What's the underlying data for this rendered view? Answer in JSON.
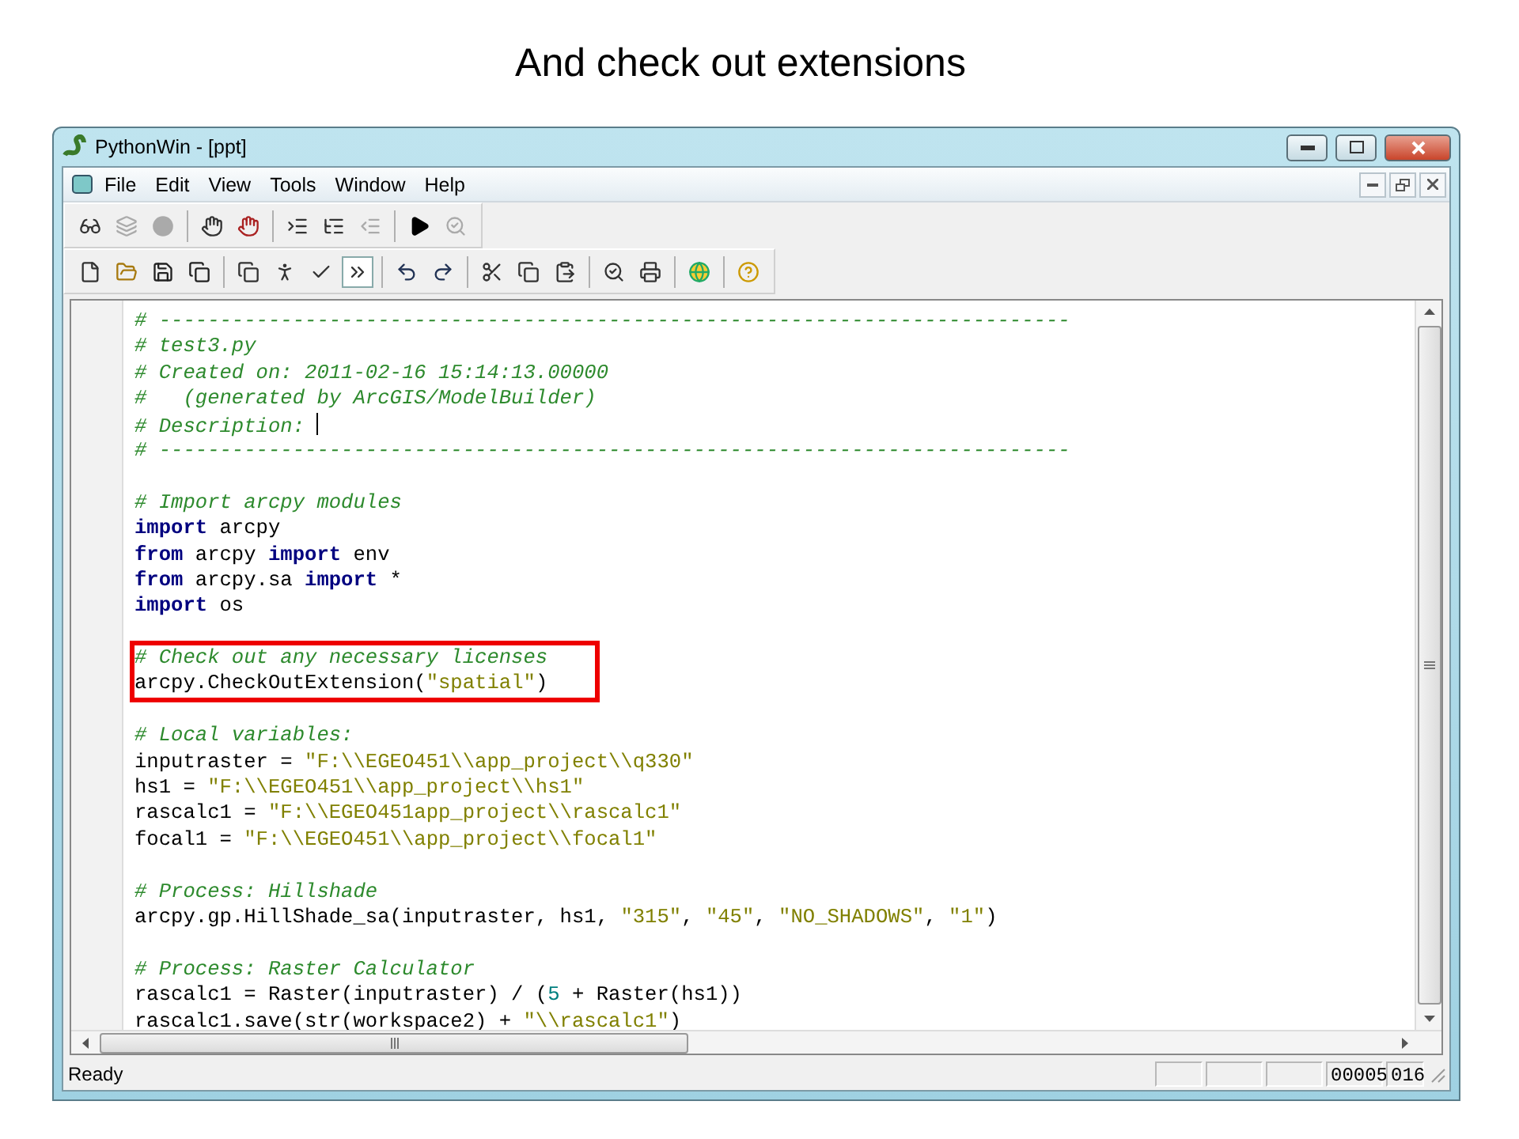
{
  "slide_title": "And check out extensions",
  "window": {
    "title": "PythonWin - [ppt]"
  },
  "menu": [
    "File",
    "Edit",
    "View",
    "Tools",
    "Window",
    "Help"
  ],
  "editor": {
    "blocks": [
      {
        "highlighted": false,
        "lines": [
          {
            "tokens": [
              {
                "kind": "comment",
                "text": "# ---------------------------------------------------------------------------"
              }
            ]
          },
          {
            "tokens": [
              {
                "kind": "comment",
                "text": "# test3.py"
              }
            ]
          },
          {
            "tokens": [
              {
                "kind": "comment",
                "text": "# Created on: 2011-02-16 15:14:13.00000"
              }
            ]
          },
          {
            "tokens": [
              {
                "kind": "comment",
                "text": "#   (generated by ArcGIS/ModelBuilder)"
              }
            ]
          },
          {
            "tokens": [
              {
                "kind": "comment",
                "text": "# Description: "
              }
            ],
            "cursor": true
          },
          {
            "tokens": [
              {
                "kind": "comment",
                "text": "# ---------------------------------------------------------------------------"
              }
            ]
          }
        ]
      },
      {
        "highlighted": false,
        "lines": [
          {
            "tokens": [
              {
                "kind": "comment",
                "text": "# Import arcpy modules"
              }
            ]
          },
          {
            "tokens": [
              {
                "kind": "keyword",
                "text": "import"
              },
              {
                "kind": "plain",
                "text": " arcpy"
              }
            ]
          },
          {
            "tokens": [
              {
                "kind": "keyword",
                "text": "from"
              },
              {
                "kind": "plain",
                "text": " arcpy "
              },
              {
                "kind": "keyword",
                "text": "import"
              },
              {
                "kind": "plain",
                "text": " env"
              }
            ]
          },
          {
            "tokens": [
              {
                "kind": "keyword",
                "text": "from"
              },
              {
                "kind": "plain",
                "text": " arcpy.sa "
              },
              {
                "kind": "keyword",
                "text": "import"
              },
              {
                "kind": "plain",
                "text": " *"
              }
            ]
          },
          {
            "tokens": [
              {
                "kind": "keyword",
                "text": "import"
              },
              {
                "kind": "plain",
                "text": " os"
              }
            ]
          }
        ]
      },
      {
        "highlighted": true,
        "lines": [
          {
            "tokens": [
              {
                "kind": "comment",
                "text": "# Check out any necessary licenses"
              }
            ]
          },
          {
            "tokens": [
              {
                "kind": "plain",
                "text": "arcpy.CheckOutExtension("
              },
              {
                "kind": "string",
                "text": "\"spatial\""
              },
              {
                "kind": "plain",
                "text": ")"
              }
            ]
          }
        ]
      },
      {
        "highlighted": false,
        "lines": [
          {
            "tokens": [
              {
                "kind": "comment",
                "text": "# Local variables:"
              }
            ]
          },
          {
            "tokens": [
              {
                "kind": "plain",
                "text": "inputraster = "
              },
              {
                "kind": "string",
                "text": "\"F:\\\\EGEO451\\\\app_project\\\\q330\""
              }
            ]
          },
          {
            "tokens": [
              {
                "kind": "plain",
                "text": "hs1 = "
              },
              {
                "kind": "string",
                "text": "\"F:\\\\EGEO451\\\\app_project\\\\hs1\""
              }
            ]
          },
          {
            "tokens": [
              {
                "kind": "plain",
                "text": "rascalc1 = "
              },
              {
                "kind": "string",
                "text": "\"F:\\\\EGEO451app_project\\\\rascalc1\""
              }
            ]
          },
          {
            "tokens": [
              {
                "kind": "plain",
                "text": "focal1 = "
              },
              {
                "kind": "string",
                "text": "\"F:\\\\EGEO451\\\\app_project\\\\focal1\""
              }
            ]
          }
        ]
      },
      {
        "highlighted": false,
        "lines": [
          {
            "tokens": [
              {
                "kind": "comment",
                "text": "# Process: Hillshade"
              }
            ]
          },
          {
            "tokens": [
              {
                "kind": "plain",
                "text": "arcpy.gp.HillShade_sa(inputraster, hs1, "
              },
              {
                "kind": "string",
                "text": "\"315\""
              },
              {
                "kind": "plain",
                "text": ", "
              },
              {
                "kind": "string",
                "text": "\"45\""
              },
              {
                "kind": "plain",
                "text": ", "
              },
              {
                "kind": "string",
                "text": "\"NO_SHADOWS\""
              },
              {
                "kind": "plain",
                "text": ", "
              },
              {
                "kind": "string",
                "text": "\"1\""
              },
              {
                "kind": "plain",
                "text": ")"
              }
            ]
          }
        ]
      },
      {
        "highlighted": false,
        "lines": [
          {
            "tokens": [
              {
                "kind": "comment",
                "text": "# Process: Raster Calculator"
              }
            ]
          },
          {
            "tokens": [
              {
                "kind": "plain",
                "text": "rascalc1 = Raster(inputraster) / ("
              },
              {
                "kind": "number",
                "text": "5"
              },
              {
                "kind": "plain",
                "text": " + Raster(hs1))"
              }
            ]
          },
          {
            "tokens": [
              {
                "kind": "plain",
                "text": "rascalc1.save(str(workspace2) + "
              },
              {
                "kind": "string",
                "text": "\"\\\\rascalc1\""
              },
              {
                "kind": "plain",
                "text": ")"
              }
            ]
          }
        ]
      }
    ]
  },
  "status_bar": {
    "message": "Ready",
    "line": "00005",
    "column": "016"
  }
}
